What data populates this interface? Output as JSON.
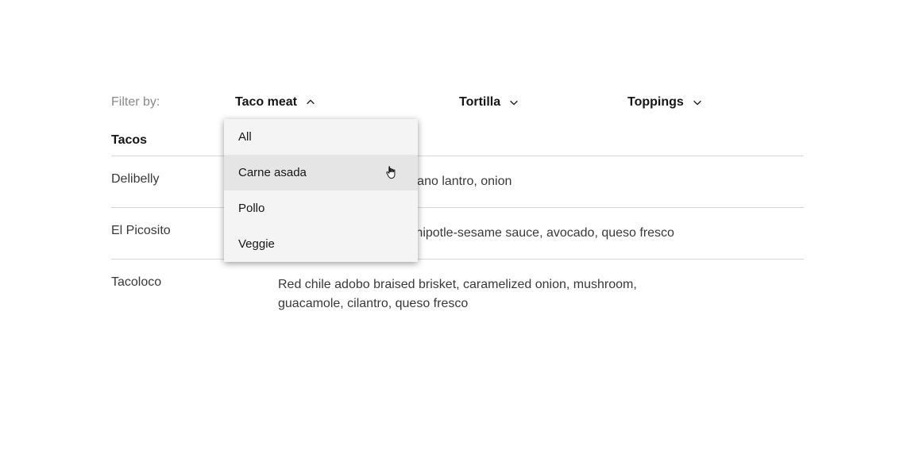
{
  "filter": {
    "label": "Filter by:",
    "filters": [
      {
        "label": "Taco meat",
        "expanded": true
      },
      {
        "label": "Tortilla",
        "expanded": false
      },
      {
        "label": "Toppings",
        "expanded": false
      }
    ]
  },
  "table": {
    "header": "Tacos",
    "rows": [
      {
        "name": "Delibelly",
        "description": "low. Honey tomatillo-serrano lantro, onion"
      },
      {
        "name": "El Picosito",
        "description": "Grilled beef tenderloin, chipotle-sesame sauce, avocado, queso fresco"
      },
      {
        "name": "Tacoloco",
        "description": "Red chile adobo braised brisket, caramelized onion, mushroom, guacamole, cilantro, queso fresco"
      }
    ]
  },
  "dropdown": {
    "options": [
      {
        "label": "All"
      },
      {
        "label": "Carne asada",
        "hover": true
      },
      {
        "label": "Pollo"
      },
      {
        "label": "Veggie"
      }
    ]
  }
}
